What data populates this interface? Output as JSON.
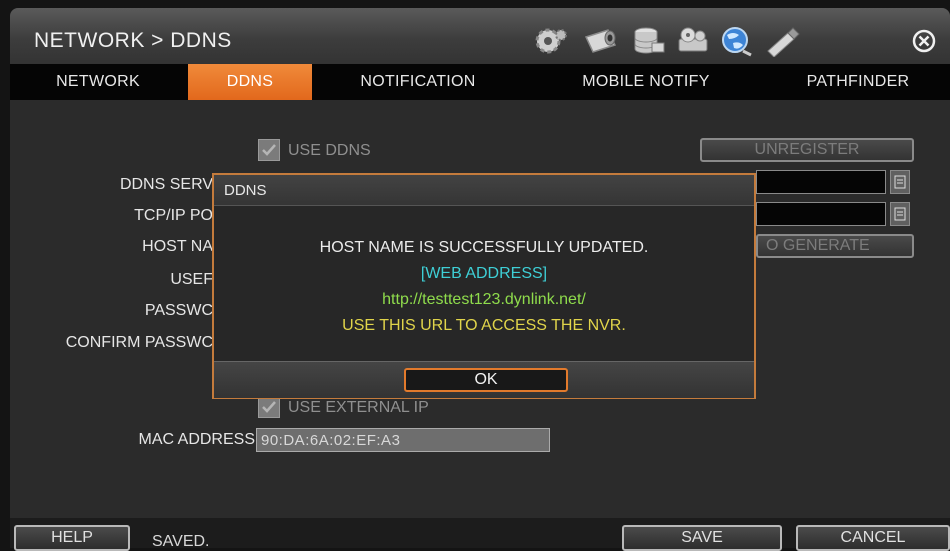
{
  "header": {
    "title": "NETWORK > DDNS",
    "icons": [
      "gear-icon",
      "camera-icon",
      "storage-icon",
      "record-icon",
      "network-globe-icon",
      "usb-icon",
      "close-icon"
    ]
  },
  "tabs": [
    {
      "label": "NETWORK",
      "active": false
    },
    {
      "label": "DDNS",
      "active": true
    },
    {
      "label": "NOTIFICATION",
      "active": false
    },
    {
      "label": "MOBILE NOTIFY",
      "active": false
    },
    {
      "label": "PATHFINDER",
      "active": false
    }
  ],
  "form": {
    "use_ddns_label": "USE DDNS",
    "unregister_label": "UNREGISTER",
    "ddns_server_label": "DDNS SERV",
    "tcp_port_label": "TCP/IP PO",
    "host_name_label": "HOST NA",
    "user_label": "USEF",
    "password_label": "PASSWC",
    "confirm_password_label": "CONFIRM PASSWC",
    "auto_generate_label": "O GENERATE",
    "use_external_ip_label": "USE EXTERNAL IP",
    "mac_address_label": "MAC ADDRESS",
    "mac_address_value": "90:DA:6A:02:EF:A3"
  },
  "dialog": {
    "title": "DDNS",
    "line1": "HOST NAME IS SUCCESSFULLY UPDATED.",
    "line2": "[WEB ADDRESS]",
    "line3": "http://testtest123.dynlink.net/",
    "line4": "USE THIS URL TO ACCESS THE NVR.",
    "ok_label": "OK"
  },
  "footer": {
    "help_label": "HELP",
    "status_text": "SAVED.",
    "save_label": "SAVE",
    "cancel_label": "CANCEL"
  },
  "colors": {
    "accent_orange": "#e2681c",
    "web_address_cyan": "#3ecfd6",
    "url_green": "#8fdc4c",
    "notice_yellow": "#e0d44a"
  }
}
